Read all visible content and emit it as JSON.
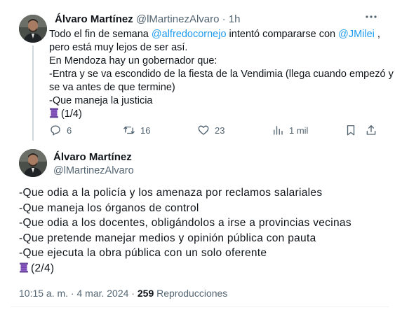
{
  "tweet1": {
    "author_name": "Álvaro Martínez",
    "author_handle": "@lMartinezAlvaro",
    "separator": "·",
    "time": "1h",
    "text": {
      "l1_a": "Todo el fin de semana ",
      "l1_mention1": "@alfredocornejo",
      "l1_b": " intentó compararse con ",
      "l1_mention2": "@JMilei",
      "l1_c": " ,",
      "l2": "pero está muy lejos de ser así.",
      "l3": "En Mendoza hay un gobernador que:",
      "l4": "-Entra y se va escondido de la fiesta de la Vendimia (llega cuando empezó y",
      "l5": "se va antes de que termine)",
      "l6": "-Que maneja la justicia",
      "l7": "(1/4)"
    },
    "actions": {
      "replies": "6",
      "reposts": "16",
      "likes": "23",
      "views": "1 mil"
    }
  },
  "tweet2": {
    "author_name": "Álvaro Martínez",
    "author_handle": "@lMartinezAlvaro",
    "lines": [
      "-Que odia a la policía y los amenaza por reclamos salariales",
      "-Que maneja los órganos de control",
      "-Que odia a los docentes, obligándolos a irse a provincias vecinas",
      "-Que pretende manejar medios y opinión pública con pauta",
      "-Que ejecuta la obra pública con un solo oferente"
    ],
    "counter": "(2/4)",
    "timestamp": "10:15 a. m. · 4 mar. 2024 ·",
    "views_count": "259",
    "views_label": "Reproducciones"
  },
  "icons": {
    "more": "more-dots-icon",
    "reply": "reply-icon",
    "repost": "repost-icon",
    "like": "heart-icon",
    "views": "views-chart-icon",
    "bookmark": "bookmark-icon",
    "share": "share-icon",
    "emoji": "thread-spool-emoji"
  },
  "colors": {
    "accent": "#1d9bf0",
    "muted": "#536471",
    "text": "#0f1419"
  }
}
